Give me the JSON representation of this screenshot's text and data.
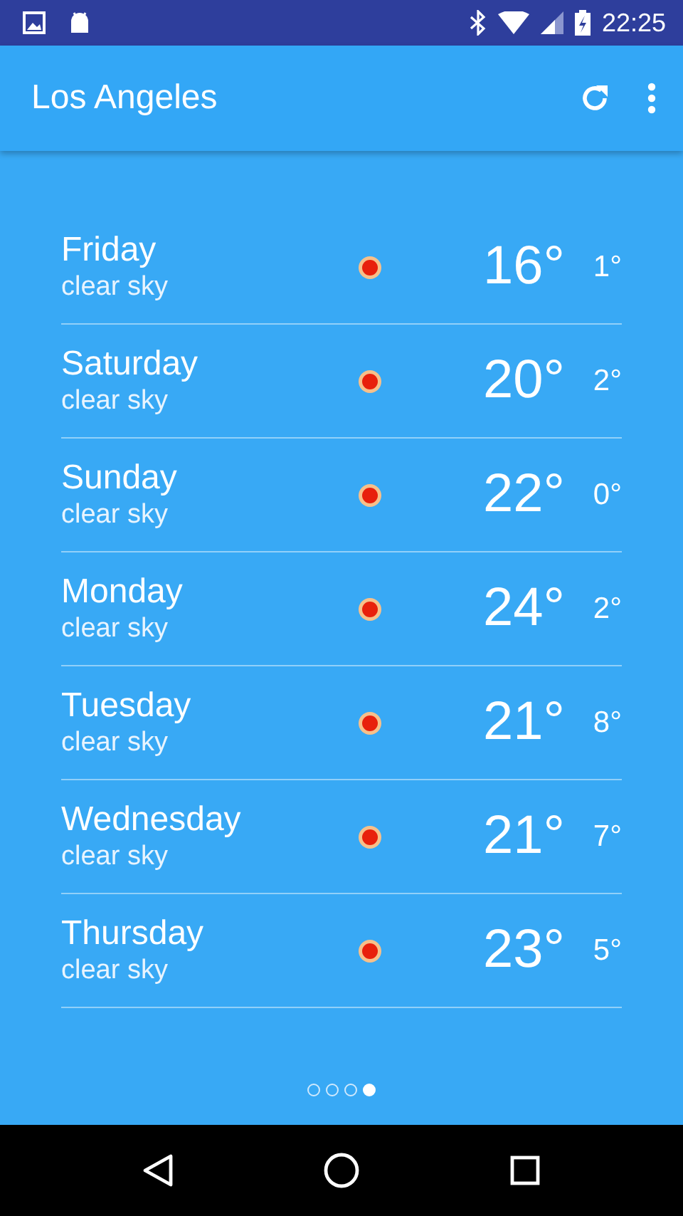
{
  "status_bar": {
    "time": "22:25"
  },
  "app_bar": {
    "title": "Los Angeles"
  },
  "forecast": [
    {
      "day": "Friday",
      "description": "clear sky",
      "high": "16°",
      "low": "1°"
    },
    {
      "day": "Saturday",
      "description": "clear sky",
      "high": "20°",
      "low": "2°"
    },
    {
      "day": "Sunday",
      "description": "clear sky",
      "high": "22°",
      "low": "0°"
    },
    {
      "day": "Monday",
      "description": "clear sky",
      "high": "24°",
      "low": "2°"
    },
    {
      "day": "Tuesday",
      "description": "clear sky",
      "high": "21°",
      "low": "8°"
    },
    {
      "day": "Wednesday",
      "description": "clear sky",
      "high": "21°",
      "low": "7°"
    },
    {
      "day": "Thursday",
      "description": "clear sky",
      "high": "23°",
      "low": "5°"
    }
  ],
  "page_indicator": [
    {
      "selected": false
    },
    {
      "selected": false
    },
    {
      "selected": false
    },
    {
      "selected": true
    }
  ]
}
